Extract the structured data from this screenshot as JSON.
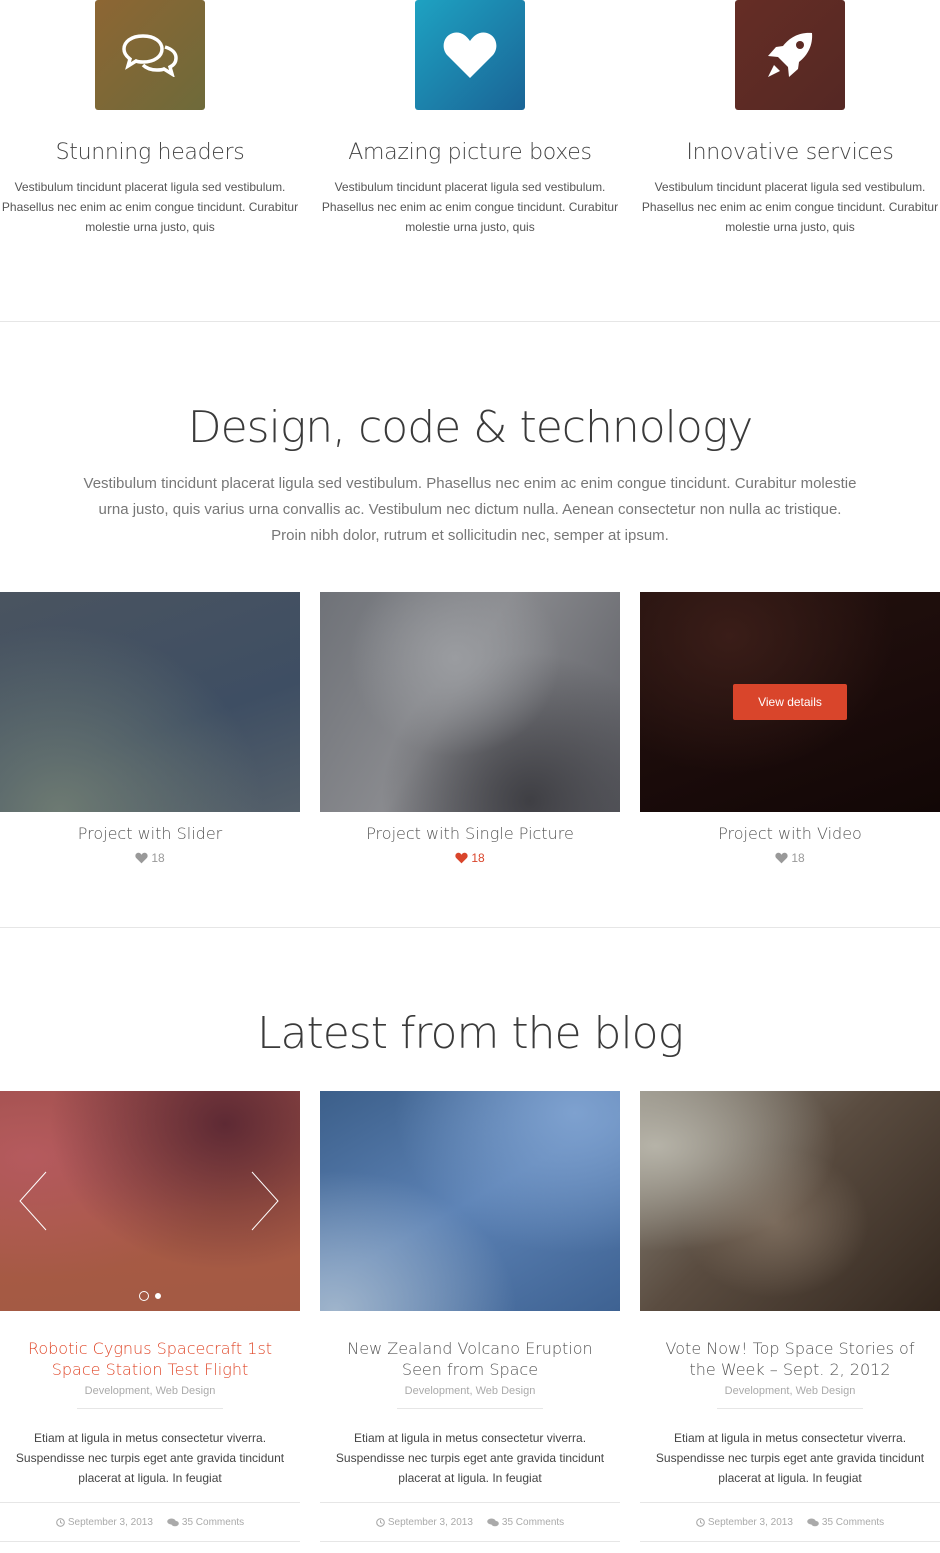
{
  "features": [
    {
      "title": "Stunning headers",
      "text": "Vestibulum tincidunt placerat ligula sed vestibulum. Phasellus nec enim ac enim congue tincidunt. Curabitur molestie urna justo, quis",
      "icon": "chat-bubbles-icon",
      "color_from": "#8d6633",
      "color_to": "#6e6a3a"
    },
    {
      "title": "Amazing picture boxes",
      "text": "Vestibulum tincidunt placerat ligula sed vestibulum. Phasellus nec enim ac enim congue tincidunt. Curabitur molestie urna justo, quis",
      "icon": "heart-icon",
      "color_from": "#1ea2c2",
      "color_to": "#1a6496"
    },
    {
      "title": "Innovative services",
      "text": "Vestibulum tincidunt placerat ligula sed vestibulum. Phasellus nec enim ac enim congue tincidunt. Curabitur molestie urna justo, quis",
      "icon": "rocket-icon",
      "color_from": "#652d25",
      "color_to": "#552824"
    }
  ],
  "design_section": {
    "title": "Design, code & technology",
    "intro": "Vestibulum tincidunt placerat ligula sed vestibulum. Phasellus nec enim ac enim congue tincidunt. Curabitur molestie urna justo, quis varius urna convallis ac. Vestibulum nec dictum nulla. Aenean consectetur non nulla ac tristique. Proin nibh dolor, rutrum et sollicitudin nec, semper at ipsum."
  },
  "projects": [
    {
      "title": "Project with Slider",
      "likes": "18",
      "liked": false
    },
    {
      "title": "Project with Single Picture",
      "likes": "18",
      "liked": true
    },
    {
      "title": "Project with Video",
      "likes": "18",
      "liked": false,
      "button": "View details"
    }
  ],
  "blog_section": {
    "title": "Latest from the blog"
  },
  "posts": [
    {
      "title": "Robotic Cygnus Spacecraft 1st Space Station Test Flight",
      "cat1": "Development",
      "cat2": "Web Design",
      "excerpt": "Etiam at ligula in metus consectetur viverra. Suspendisse nec turpis eget ante gravida tincidunt placerat at ligula. In feugiat",
      "date": "September 3, 2013",
      "comments": "35 Comments",
      "active": true
    },
    {
      "title": "New Zealand Volcano Eruption Seen from Space",
      "cat1": "Development",
      "cat2": "Web Design",
      "excerpt": "Etiam at ligula in metus consectetur viverra. Suspendisse nec turpis eget ante gravida tincidunt placerat at ligula. In feugiat",
      "date": "September 3, 2013",
      "comments": "35 Comments",
      "active": false
    },
    {
      "title": "Vote Now! Top Space Stories of the Week – Sept. 2, 2012",
      "cat1": "Development",
      "cat2": "Web Design",
      "excerpt": "Etiam at ligula in metus consectetur viverra. Suspendisse nec turpis eget ante gravida tincidunt placerat at ligula. In feugiat",
      "date": "September 3, 2013",
      "comments": "35 Comments",
      "active": false
    }
  ],
  "colors": {
    "accent": "#d9452b"
  }
}
